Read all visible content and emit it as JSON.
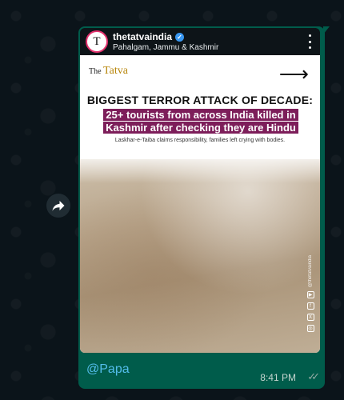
{
  "post": {
    "username": "thetatvaindia",
    "location": "Pahalgam, Jammu & Kashmir",
    "avatar_letter": "T"
  },
  "media": {
    "logo_prefix": "The",
    "logo_main": "Tatva",
    "headline": "BIGGEST TERROR ATTACK OF DECADE:",
    "sub_line_1": "25+ tourists from across India killed in",
    "sub_line_2": "Kashmir after checking they are Hindu",
    "caption": "Laskhar-e-Taiba claims responsibility, families left crying with bodies.",
    "side_handle": "@thetatvaindia"
  },
  "message": {
    "text": "@Papa",
    "time": "8:41 PM"
  },
  "icons": {
    "forward": "forward-icon",
    "verified": "verified-badge-icon",
    "more": "more-vertical-icon",
    "arrow": "arrow-right-icon",
    "read": "double-check-icon"
  },
  "colors": {
    "chat_bg": "#0b141a",
    "bubble": "#005c4b",
    "mention": "#53bdeb",
    "highlight": "#7d1e5a"
  }
}
